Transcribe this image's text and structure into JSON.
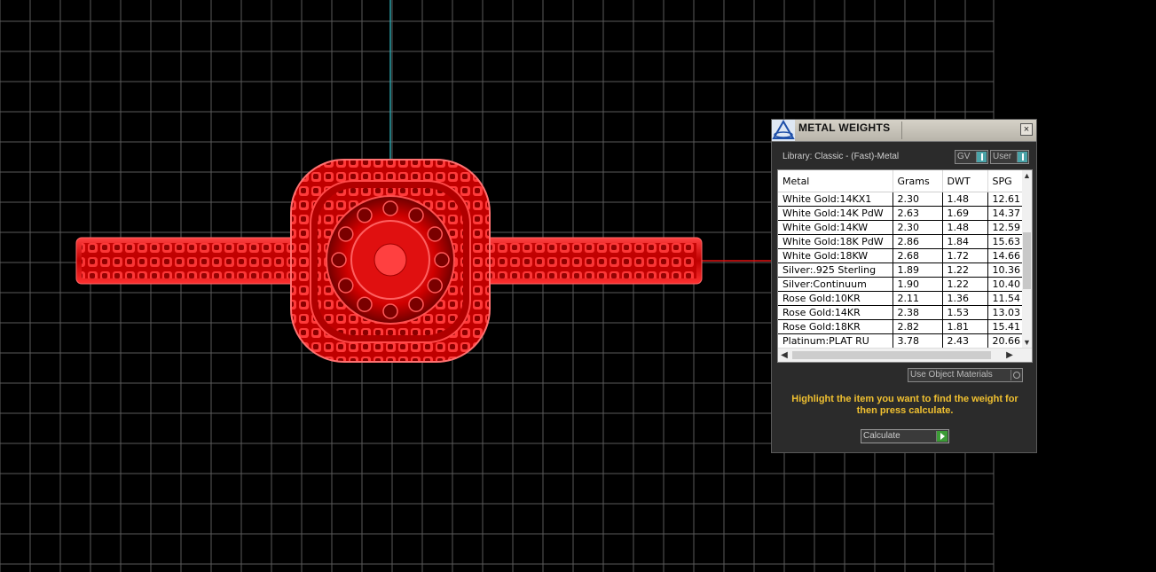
{
  "viewport": {
    "model": "ring-3d-model",
    "accent": "#e31010",
    "axis_color": "#2aa0a8",
    "grid_color": "#5a5a5a"
  },
  "panel": {
    "title": "METAL WEIGHTS",
    "close_label": "×",
    "library_label": "Library: Classic - (Fast)-Metal",
    "gv_label": "GV",
    "user_label": "User",
    "columns": [
      "Metal",
      "Grams",
      "DWT",
      "SPG"
    ],
    "rows": [
      {
        "metal": "White Gold:14KX1",
        "grams": "2.30",
        "dwt": "1.48",
        "spg": "12.61"
      },
      {
        "metal": "White Gold:14K PdW",
        "grams": "2.63",
        "dwt": "1.69",
        "spg": "14.37"
      },
      {
        "metal": "White Gold:14KW",
        "grams": "2.30",
        "dwt": "1.48",
        "spg": "12.59"
      },
      {
        "metal": "White Gold:18K PdW",
        "grams": "2.86",
        "dwt": "1.84",
        "spg": "15.63"
      },
      {
        "metal": "White Gold:18KW",
        "grams": "2.68",
        "dwt": "1.72",
        "spg": "14.66"
      },
      {
        "metal": "Silver:.925 Sterling",
        "grams": "1.89",
        "dwt": "1.22",
        "spg": "10.36"
      },
      {
        "metal": "Silver:Continuum",
        "grams": "1.90",
        "dwt": "1.22",
        "spg": "10.40"
      },
      {
        "metal": "Rose Gold:10KR",
        "grams": "2.11",
        "dwt": "1.36",
        "spg": "11.54"
      },
      {
        "metal": "Rose Gold:14KR",
        "grams": "2.38",
        "dwt": "1.53",
        "spg": "13.03"
      },
      {
        "metal": "Rose Gold:18KR",
        "grams": "2.82",
        "dwt": "1.81",
        "spg": "15.41"
      },
      {
        "metal": "Platinum:PLAT RU",
        "grams": "3.78",
        "dwt": "2.43",
        "spg": "20.66"
      }
    ],
    "use_materials_label": "Use Object Materials",
    "hint": "Highlight the item you want to find the weight for then press calculate.",
    "calculate_label": "Calculate",
    "hint_color": "#f0c030"
  }
}
